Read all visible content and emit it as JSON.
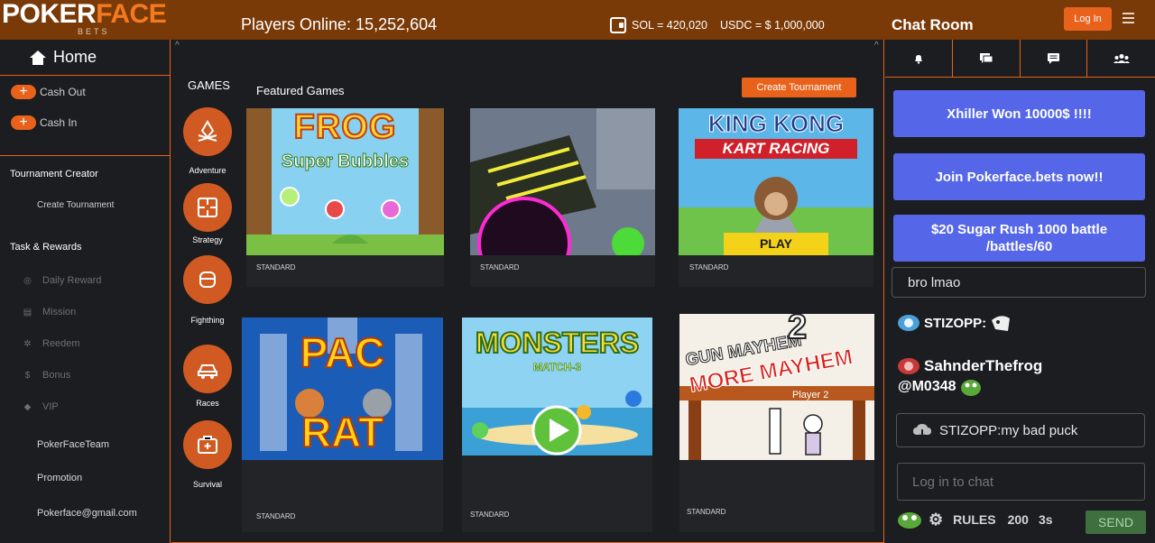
{
  "header": {
    "logo_part1": "POKER",
    "logo_part2": "FACE",
    "logo_sub": "BETS",
    "players_online": "Players Online: 15,252,604",
    "sol_balance": "SOL =  420,020",
    "usdc_balance": "USDC = $ 1,000,000",
    "chat_title": "Chat Room",
    "login_label": "Log In"
  },
  "sidebar": {
    "home_label": "Home",
    "cash_out": "Cash Out",
    "cash_in": "Cash In",
    "tournament_creator": "Tournament Creator",
    "create_tournament": "Create Tournament",
    "task_rewards": "Task & Rewards",
    "task_items": [
      "Daily Reward",
      "Mission",
      "Reedem",
      "Bonus",
      "VIP"
    ],
    "footer_items": [
      "PokerFaceTeam",
      "Promotion",
      "Pokerface@gmail.com"
    ]
  },
  "main": {
    "games_label": "GAMES",
    "categories": [
      "Adventure",
      "Strategy",
      "Fighthing",
      "Races",
      "Survival"
    ],
    "featured_label": "Featured Games",
    "create_tournament_btn": "Create Tournament",
    "cards": [
      {
        "title_top": "FROG",
        "title_bottom": "Super Bubbles",
        "tag": "STANDARD"
      },
      {
        "tag": "STANDARD"
      },
      {
        "title_top": "KING KONG",
        "title_bottom": "KART RACING",
        "cta": "PLAY",
        "tag": "STANDARD"
      },
      {
        "title_top": "PAC",
        "title_bottom": "RAT",
        "tag": "STANDARD"
      },
      {
        "title_top": "MONSTERS",
        "title_bottom": "MATCH-3",
        "tag": "STANDARD"
      },
      {
        "title_top": "GUN MAYHEM",
        "title_num": "2",
        "title_bottom": "MORE MAYHEM",
        "sub": "Player 2",
        "tag": "STANDARD"
      }
    ]
  },
  "chat": {
    "announcements": [
      "Xhiller Won 10000$ !!!!",
      "Join Pokerface.bets now!!",
      "$20 Sugar Rush 1000 battle /battles/60"
    ],
    "message_preview": "bro lmao",
    "user1": "STIZOPP:",
    "user2": "SahnderThefrog",
    "user2_mention": "@M0348",
    "reply_text": "STIZOPP:my bad puck",
    "input_placeholder": "Log in to chat",
    "rules_label": "RULES",
    "char_limit": "200",
    "cooldown": "3s",
    "send_label": "SEND"
  },
  "colors": {
    "accent": "#e8621c",
    "topbar": "#7a3a08",
    "announce": "#5567e8",
    "send": "#3f6e3f"
  }
}
